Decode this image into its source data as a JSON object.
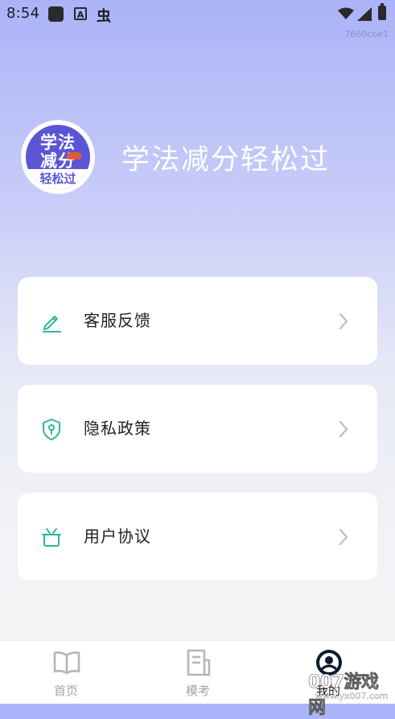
{
  "status_bar": {
    "time": "8:54",
    "icons": [
      "square-app-icon",
      "text-a-icon",
      "bug-icon",
      "wifi-icon",
      "signal-icon",
      "battery-icon"
    ],
    "bug_glyph": "虫"
  },
  "build_id": "7660cbe1",
  "profile": {
    "avatar_line1": "学法",
    "avatar_line2": "减分",
    "avatar_foot": "轻松过",
    "app_title": "学法减分轻松过"
  },
  "menu": {
    "items": [
      {
        "label": "客服反馈",
        "icon": "edit-pencil-icon"
      },
      {
        "label": "隐私政策",
        "icon": "shield-icon"
      },
      {
        "label": "用户协议",
        "icon": "gift-box-icon"
      }
    ]
  },
  "tabs": [
    {
      "label": "首页",
      "icon": "book-icon",
      "active": false
    },
    {
      "label": "模考",
      "icon": "document-icon",
      "active": false
    },
    {
      "label": "我的",
      "icon": "user-icon",
      "active": true
    }
  ],
  "watermark": {
    "main": "007游戏网",
    "sub": "www.yx007.com"
  },
  "colors": {
    "accent": "#2bb999",
    "avatar_purple": "#5b55d4",
    "gradient_top": "#aab3f7",
    "background": "#f4f4f6"
  }
}
